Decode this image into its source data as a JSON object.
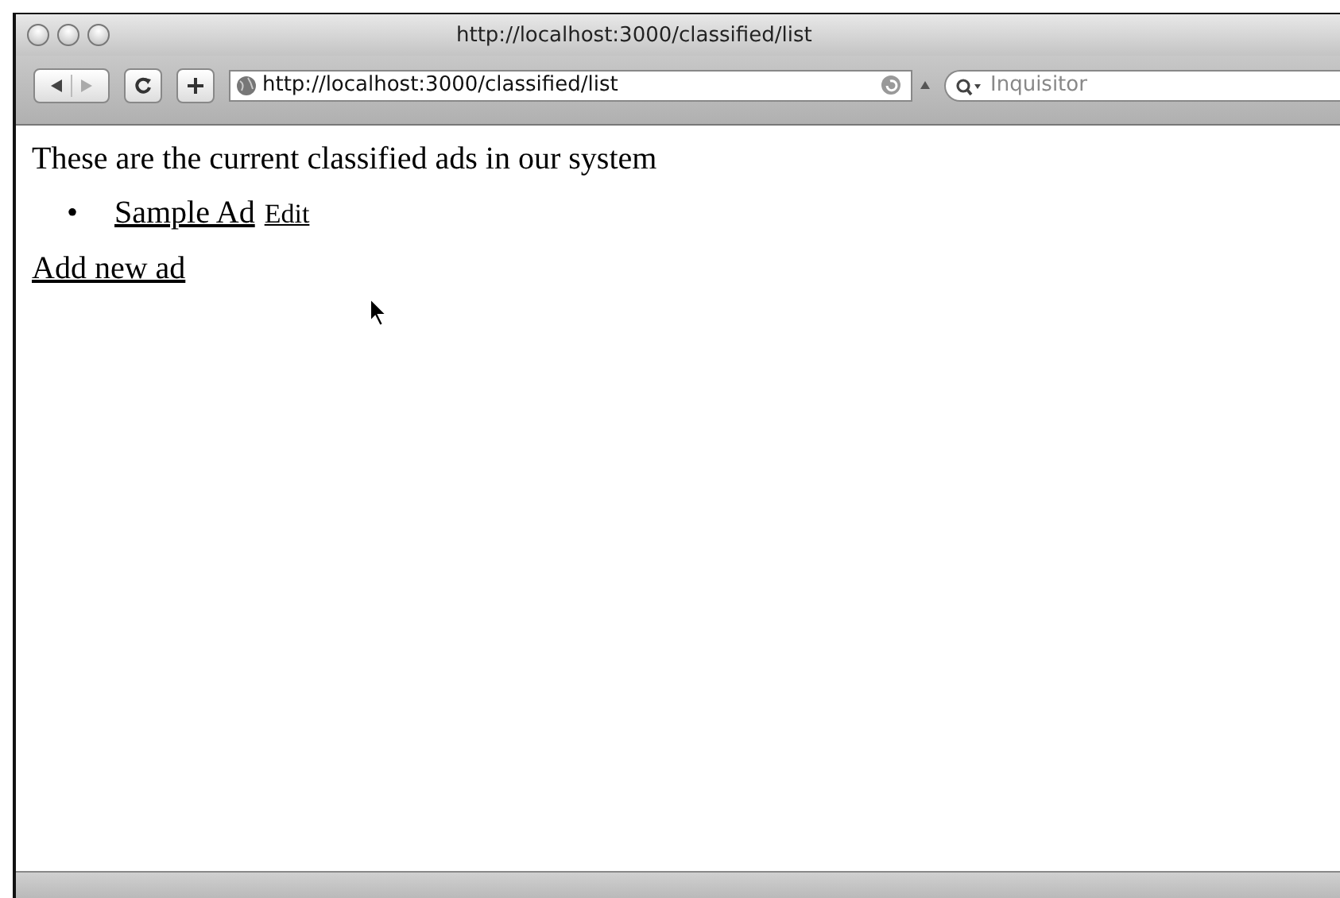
{
  "window": {
    "title": "http://localhost:3000/classified/list"
  },
  "toolbar": {
    "address": "http://localhost:3000/classified/list",
    "search": {
      "placeholder": "Inquisitor"
    }
  },
  "page": {
    "intro": "These are the current classified ads in our system",
    "ads": [
      {
        "bullet": "•",
        "title": "Sample Ad",
        "edit": "Edit"
      }
    ],
    "add_link": "Add new ad"
  }
}
